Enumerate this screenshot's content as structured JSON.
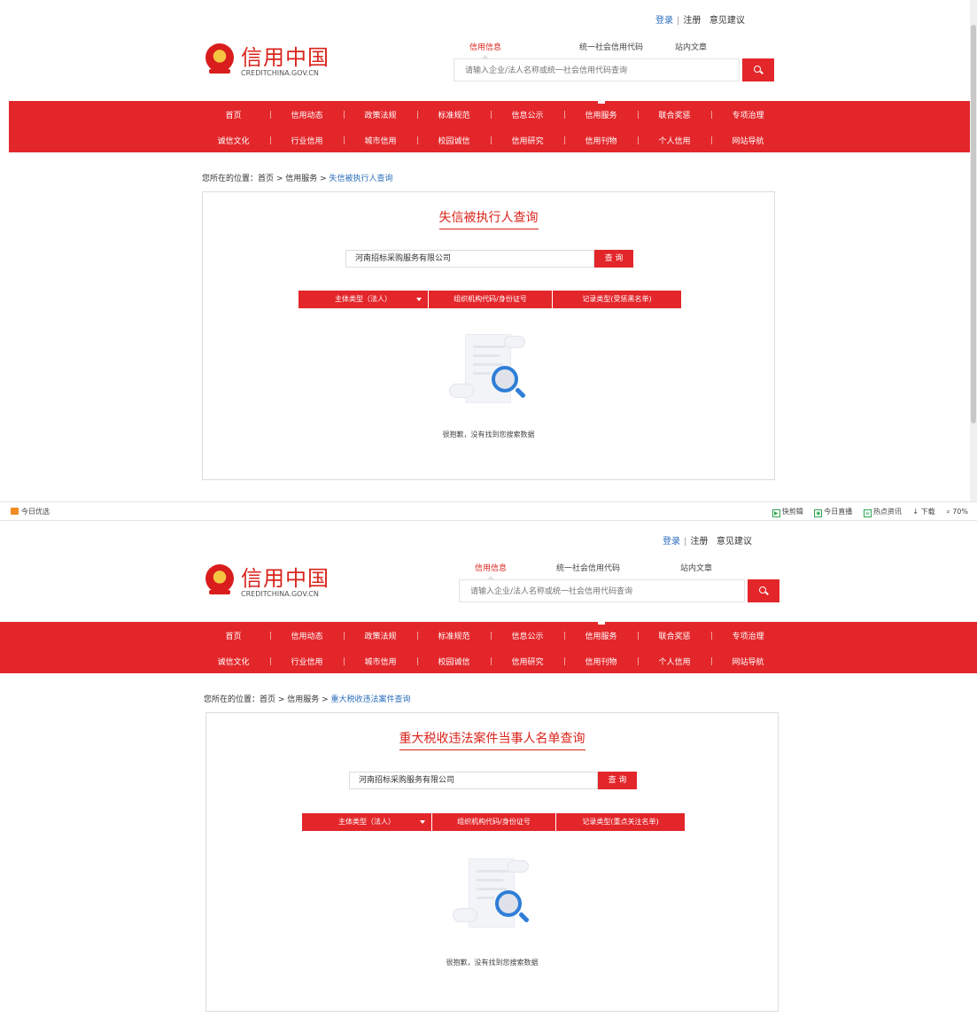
{
  "top_links": {
    "login": "登录",
    "sep": "|",
    "register": "注册",
    "feedback": "意见建议"
  },
  "logo": {
    "cn": "信用中国",
    "en": "CREDITCHINA.GOV.CN"
  },
  "search": {
    "tabs": [
      "信用信息",
      "统一社会信用代码",
      "站内文章"
    ],
    "placeholder": "请输入企业/法人名称或统一社会信用代码查询"
  },
  "nav": {
    "row1": [
      "首页",
      "信用动态",
      "政策法规",
      "标准规范",
      "信息公示",
      "信用服务",
      "联合奖惩",
      "专项治理"
    ],
    "row2": [
      "诚信文化",
      "行业信用",
      "城市信用",
      "校园诚信",
      "信用研究",
      "信用刊物",
      "个人信用",
      "网站导航"
    ]
  },
  "breadcrumb_prefix": "您所在的位置：首页 > 信用服务 > ",
  "screens": [
    {
      "breadcrumb_current": "失信被执行人查询",
      "panel_title": "失信被执行人查询",
      "query_value": "河南招标采购服务有限公司",
      "query_button": "查 询",
      "filters": [
        "主体类型（法人）",
        "组织机构代码/身份证号",
        "记录类型(受惩黑名单)"
      ],
      "empty_message": "很抱歉，没有找到您搜索数据"
    },
    {
      "breadcrumb_current": "重大税收违法案件查询",
      "panel_title": "重大税收违法案件当事人名单查询",
      "query_value": "河南招标采购服务有限公司",
      "query_button": "查 询",
      "filters": [
        "主体类型（法人）",
        "组织机构代码/身份证号",
        "记录类型(重点关注名单)"
      ],
      "empty_message": "很抱歉，没有找到您搜索数据"
    }
  ],
  "statusbar": {
    "left": "今日优选",
    "right": [
      "快剪辑",
      "今日直播",
      "热点资讯",
      "下载",
      "70%"
    ]
  }
}
